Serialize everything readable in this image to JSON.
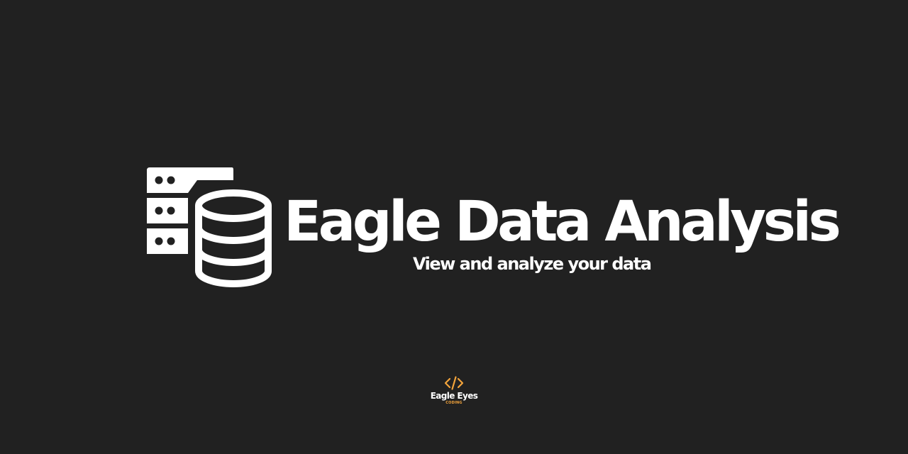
{
  "hero": {
    "logo_icon": "database-server-icon",
    "title": "Eagle Data Analysis",
    "subtitle": "View and analyze your data"
  },
  "footer": {
    "logo_icon": "code-brackets-icon",
    "name": "Eagle Eyes",
    "tag": "CODING"
  },
  "colors": {
    "background": "#212121",
    "foreground": "#ffffff",
    "accent": "#f3a43b"
  }
}
